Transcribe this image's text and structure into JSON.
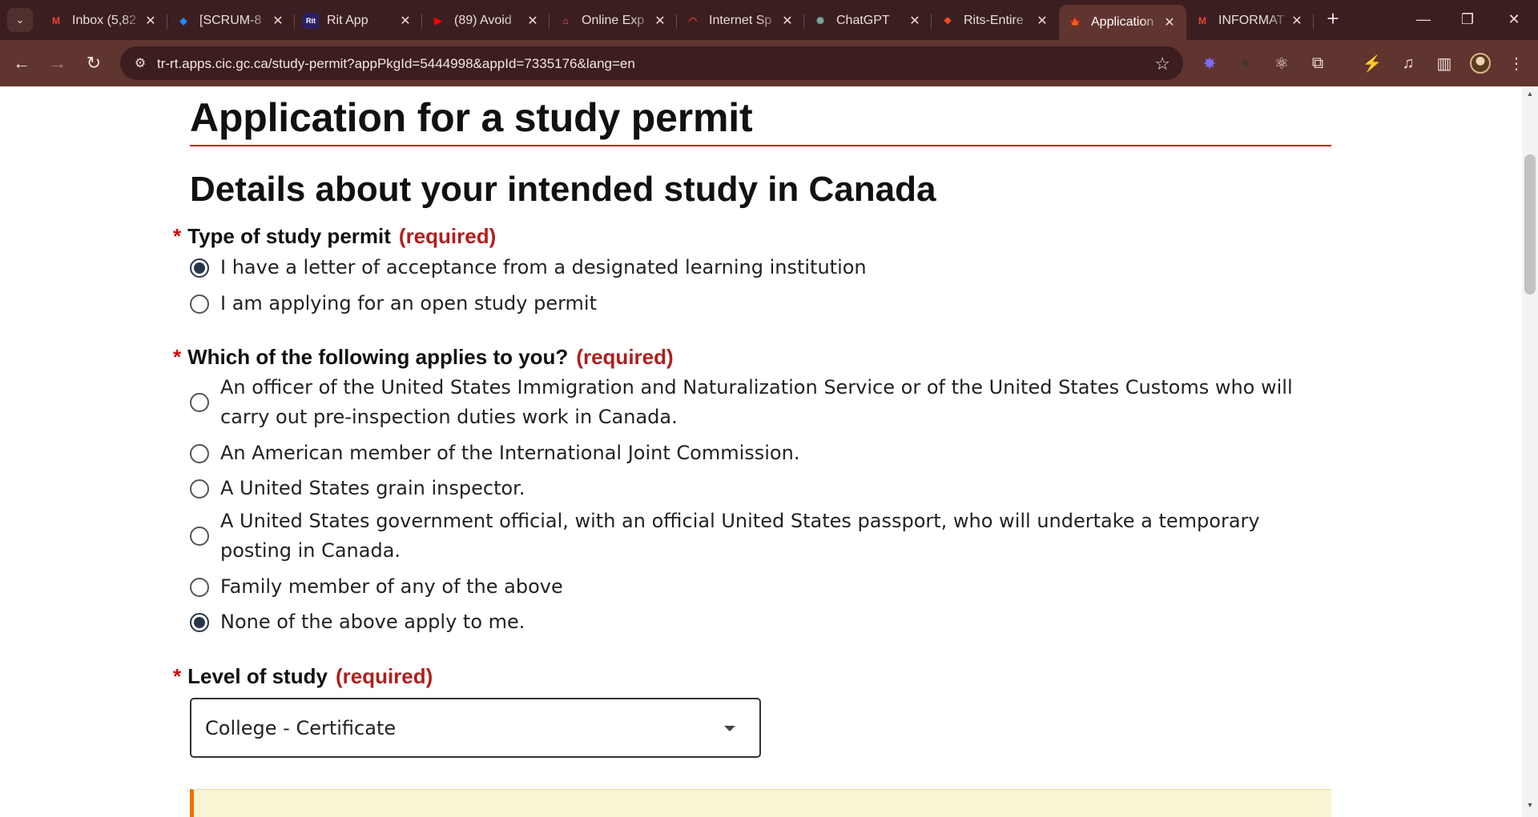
{
  "browser": {
    "tabs": [
      {
        "title": "Inbox (5,82",
        "icon": "gmail-icon",
        "glyph": "M",
        "color": "#ea4335"
      },
      {
        "title": "[SCRUM-8",
        "icon": "jira-icon",
        "glyph": "◆",
        "color": "#2684ff"
      },
      {
        "title": "Rit App",
        "icon": "rit-app-icon",
        "glyph": "Rit",
        "color": "#ffffff"
      },
      {
        "title": "(89) Avoid",
        "icon": "youtube-icon",
        "glyph": "▶",
        "color": "#ff0000"
      },
      {
        "title": "Online Exp",
        "icon": "airbnb-icon",
        "glyph": "⌂",
        "color": "#ff5a5f"
      },
      {
        "title": "Internet Sp",
        "icon": "speedtest-icon",
        "glyph": "◠",
        "color": "#e0373a"
      },
      {
        "title": "ChatGPT",
        "icon": "chatgpt-icon",
        "glyph": "✺",
        "color": "#74aa9c"
      },
      {
        "title": "Rits-Entire",
        "icon": "figma-icon",
        "glyph": "❖",
        "color": "#f24e1e"
      },
      {
        "title": "Application",
        "icon": "maple-leaf-icon",
        "glyph": "🍁",
        "color": "#d3080c",
        "active": true
      },
      {
        "title": "INFORMAT",
        "icon": "gmail-icon",
        "glyph": "M",
        "color": "#ea4335"
      }
    ],
    "url": "tr-rt.apps.cic.gc.ca/study-permit?appPkgId=5444998&appId=7335176&lang=en"
  },
  "page": {
    "title": "Application for a study permit",
    "section_title": "Details about your intended study in Canada",
    "required_mark": "*",
    "required_text": "(required)",
    "q1": {
      "label": "Type of study permit",
      "options": [
        {
          "text": "I have a letter of acceptance from a designated learning institution",
          "checked": true
        },
        {
          "text": "I am applying for an open study permit",
          "checked": false
        }
      ]
    },
    "q2": {
      "label": "Which of the following applies to you?",
      "options": [
        {
          "text": "An officer of the United States Immigration and Naturalization Service or of the United States Customs who will carry out pre-inspection duties work in Canada.",
          "checked": false
        },
        {
          "text": "An American member of the International Joint Commission.",
          "checked": false
        },
        {
          "text": "A United States grain inspector.",
          "checked": false
        },
        {
          "text": "A United States government official, with an official United States passport, who will undertake a temporary posting in Canada.",
          "checked": false
        },
        {
          "text": "Family member of any of the above",
          "checked": false
        },
        {
          "text": "None of the above apply to me.",
          "checked": true
        }
      ]
    },
    "q3": {
      "label": "Level of study",
      "selected": "College - Certificate"
    }
  }
}
